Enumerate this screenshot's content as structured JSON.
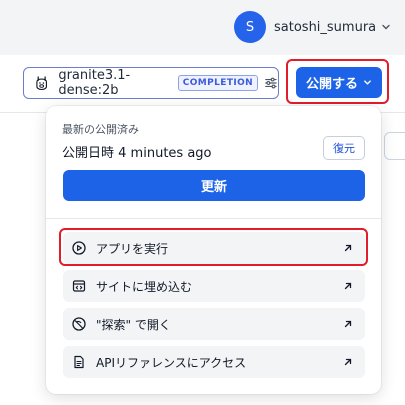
{
  "user": {
    "avatar_initial": "S",
    "name": "satoshi_sumura"
  },
  "model_selector": {
    "name": "granite3.1-dense:2b",
    "badge": "COMPLETION"
  },
  "publish": {
    "label": "公開する"
  },
  "popover": {
    "heading": "最新の公開済み",
    "published_label": "公開日時",
    "published_time": "4 minutes ago",
    "restore_label": "復元",
    "update_label": "更新",
    "actions": [
      {
        "label": "アプリを実行",
        "icon": "play-icon"
      },
      {
        "label": "サイトに埋め込む",
        "icon": "embed-icon"
      },
      {
        "label": "\"探索\" で開く",
        "icon": "compass-icon"
      },
      {
        "label": "APIリファレンスにアクセス",
        "icon": "document-icon"
      }
    ]
  },
  "colors": {
    "primary": "#1d63e8",
    "highlight": "#e11d2a",
    "avatar": "#2563eb"
  }
}
